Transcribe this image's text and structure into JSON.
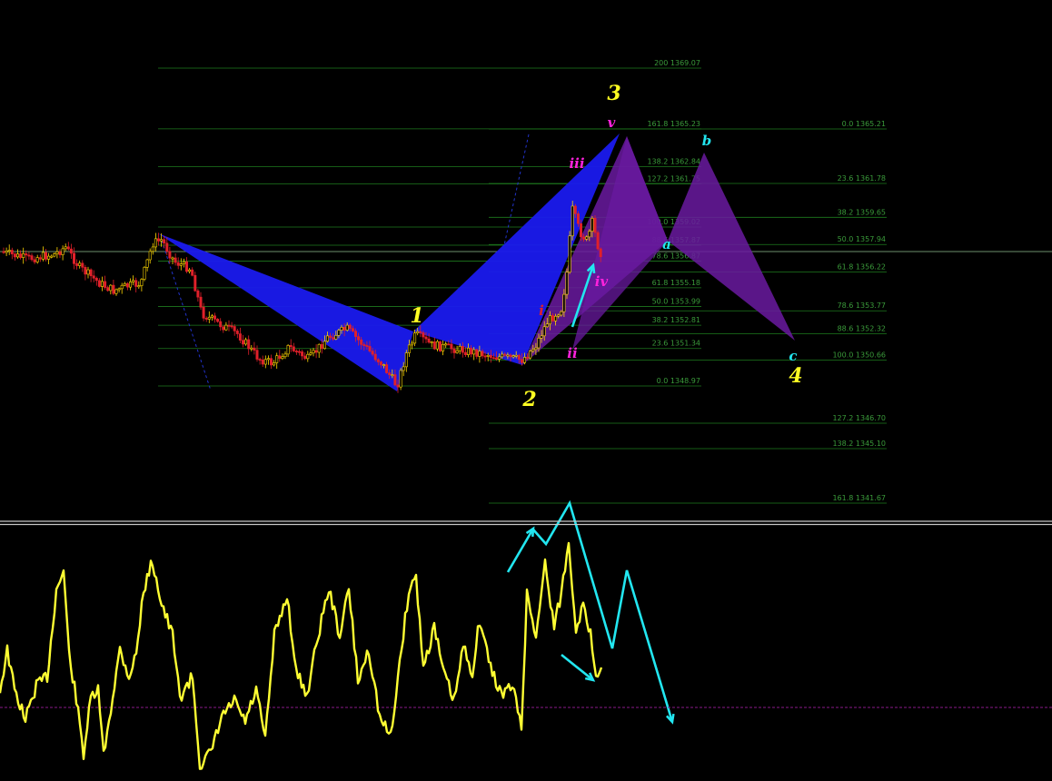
{
  "chart_data": {
    "type": "candlestick",
    "colors": {
      "background": "#000000",
      "fib_line": "#1e7a1e",
      "fib_text": "#3a9a3a",
      "bull_candle": "#ffd700",
      "bear_candle": "#e0202a",
      "pattern_blue": "#1a1aee",
      "pattern_purple": "#6a1aa0",
      "oscillator": "#ffff33",
      "arrow": "#22e6f0",
      "wave_yellow": "#ffff22",
      "wave_magenta": "#ff22dd",
      "wave_cyan": "#22e6f0",
      "divider": "#c8c8c8",
      "zero_line": "#8a1a8a",
      "current_price_line": "#8fbf8f"
    },
    "fib_left_labels": [
      {
        "ratio": "200",
        "price": 1369.07
      },
      {
        "ratio": "161.8",
        "price": 1365.23
      },
      {
        "ratio": "138.2",
        "price": 1362.84
      },
      {
        "ratio": "127.2",
        "price": 1361.75
      },
      {
        "ratio": "100.0",
        "price": 1359.02
      },
      {
        "ratio": "88.6",
        "price": 1357.87
      },
      {
        "ratio": "78.6",
        "price": 1356.87
      },
      {
        "ratio": "61.8",
        "price": 1355.18
      },
      {
        "ratio": "50.0",
        "price": 1353.99
      },
      {
        "ratio": "38.2",
        "price": 1352.81
      },
      {
        "ratio": "23.6",
        "price": 1351.34
      },
      {
        "ratio": "0.0",
        "price": 1348.97
      }
    ],
    "fib_right_labels": [
      {
        "ratio": "0.0",
        "price": 1365.21
      },
      {
        "ratio": "23.6",
        "price": 1361.78
      },
      {
        "ratio": "38.2",
        "price": 1359.65
      },
      {
        "ratio": "50.0",
        "price": 1357.94
      },
      {
        "ratio": "61.8",
        "price": 1356.22
      },
      {
        "ratio": "78.6",
        "price": 1353.77
      },
      {
        "ratio": "88.6",
        "price": 1352.32
      },
      {
        "ratio": "100.0",
        "price": 1350.66
      },
      {
        "ratio": "127.2",
        "price": 1346.7
      },
      {
        "ratio": "138.2",
        "price": 1345.1
      },
      {
        "ratio": "161.8",
        "price": 1341.67
      }
    ],
    "wave_labels": [
      {
        "text": "1",
        "color": "yellow",
        "size": "big"
      },
      {
        "text": "2",
        "color": "yellow",
        "size": "big"
      },
      {
        "text": "3",
        "color": "yellow",
        "size": "big"
      },
      {
        "text": "4",
        "color": "yellow",
        "size": "big"
      },
      {
        "text": "i",
        "color": "red",
        "size": "small"
      },
      {
        "text": "ii",
        "color": "magenta",
        "size": "small"
      },
      {
        "text": "iii",
        "color": "magenta",
        "size": "small"
      },
      {
        "text": "iv",
        "color": "magenta",
        "size": "small"
      },
      {
        "text": "v",
        "color": "magenta",
        "size": "small"
      },
      {
        "text": "a",
        "color": "cyan",
        "size": "small"
      },
      {
        "text": "b",
        "color": "cyan",
        "size": "small"
      },
      {
        "text": "c",
        "color": "cyan",
        "size": "small"
      }
    ]
  }
}
